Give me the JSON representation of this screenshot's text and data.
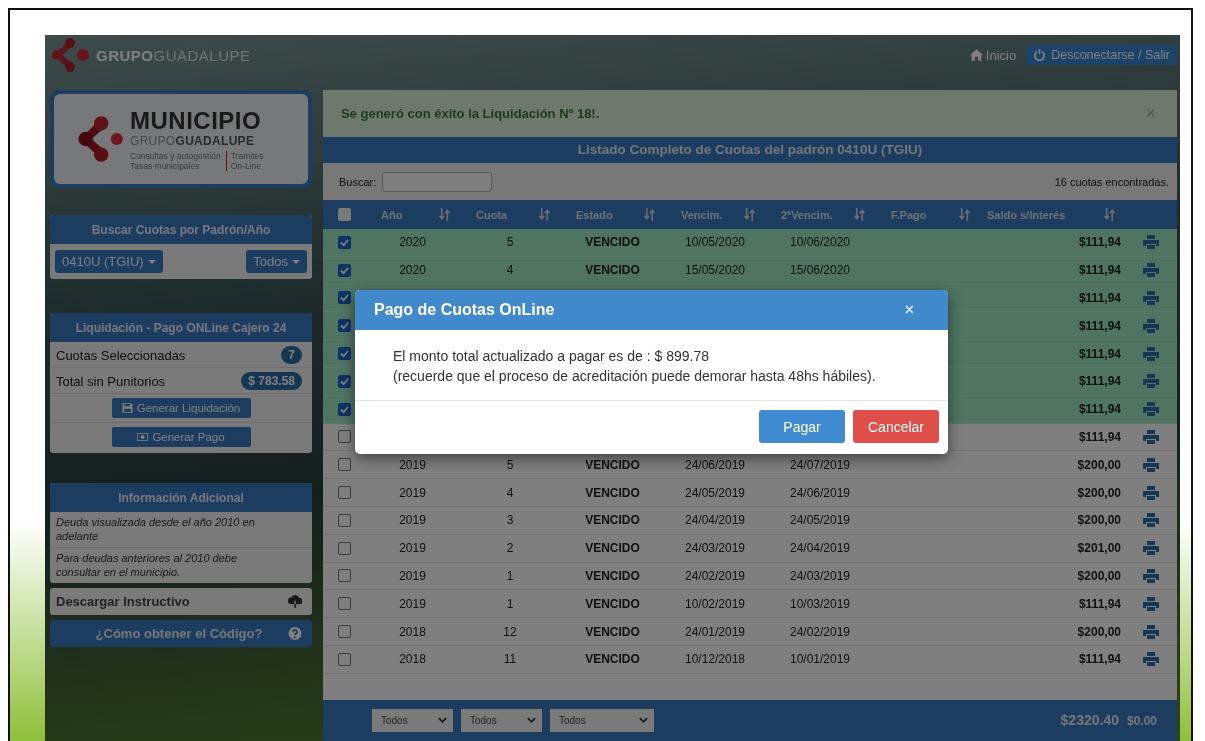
{
  "brand": {
    "logo_text": "**GRUPO**GUADALUPE"
  },
  "nav": {
    "home": "Inicio",
    "logout": "Desconectarse / Salir"
  },
  "municipio_card": {
    "title": "MUNICIPIO",
    "subtitle": "GRUPO**GUADALUPE**",
    "tagline": [
      "Consultas y autogestión",
      "Tasas municipales"
    ],
    "tramites": [
      "Tramites",
      "On-Line"
    ]
  },
  "search_panel": {
    "title": "Buscar Cuotas por Padrón/Año",
    "padron": "0410U (TGIU)",
    "year": "Todos"
  },
  "liquidacion_panel": {
    "title": "Liquidación - Pago ONLine Cajero 24",
    "items": [
      {
        "label": "Cuotas Seleccionadas",
        "badge": "7"
      },
      {
        "label": "Total sin Punitorios",
        "badge": "$ 783.58"
      }
    ],
    "buttons": [
      {
        "kind": "save",
        "label": "Generar Liquidación"
      },
      {
        "kind": "money",
        "label": "Generar Pago"
      }
    ]
  },
  "info_panel": {
    "title": "Información Adicional",
    "notes": [
      "Deuda visualizada desde el año 2010 en adelante",
      "Para deudas anteriores al 2010 debe consultar en el municipio."
    ]
  },
  "links": [
    {
      "kind": "download",
      "label": "Descargar Instructivo"
    },
    {
      "kind": "help",
      "label": "¿Cómo obtener el Código?"
    }
  ],
  "alert": {
    "message": "Se generó con éxito la Liquidación Nº 18!.",
    "close": "×"
  },
  "table": {
    "title": "Listado Completo de Cuotas del padrón 0410U (TGIU)",
    "search_label": "Buscar:",
    "count": "16 cuotas encontradas.",
    "all_checked": false,
    "columns": [
      "Año",
      "Cuota",
      "Estado",
      "Vencim.",
      "2ºVencim.",
      "F.Pago",
      "Saldo s/Interés"
    ],
    "rows": [
      {
        "checked": true,
        "year": "2020",
        "cuota": "5",
        "estado": "VENCIDO",
        "vencim": "10/05/2020",
        "vencim2": "10/06/2020",
        "saldo": "$111,94"
      },
      {
        "checked": true,
        "year": "2020",
        "cuota": "4",
        "estado": "VENCIDO",
        "vencim": "15/05/2020",
        "vencim2": "15/06/2020",
        "saldo": "$111,94"
      },
      {
        "checked": true,
        "saldo": "$111,94"
      },
      {
        "checked": true,
        "saldo": "$111,94"
      },
      {
        "checked": true,
        "saldo": "$111,94"
      },
      {
        "checked": true,
        "saldo": "$111,94"
      },
      {
        "checked": true,
        "saldo": "$111,94"
      },
      {
        "checked": false,
        "saldo": "$111,94"
      },
      {
        "checked": false,
        "year": "2019",
        "cuota": "5",
        "estado": "VENCIDO",
        "vencim": "24/06/2019",
        "vencim2": "24/07/2019",
        "saldo": "$200,00"
      },
      {
        "checked": false,
        "year": "2019",
        "cuota": "4",
        "estado": "VENCIDO",
        "vencim": "24/05/2019",
        "vencim2": "24/06/2019",
        "saldo": "$200,00"
      },
      {
        "checked": false,
        "year": "2019",
        "cuota": "3",
        "estado": "VENCIDO",
        "vencim": "24/04/2019",
        "vencim2": "24/05/2019",
        "saldo": "$200,00"
      },
      {
        "checked": false,
        "year": "2019",
        "cuota": "2",
        "estado": "VENCIDO",
        "vencim": "24/03/2019",
        "vencim2": "24/04/2019",
        "saldo": "$201,00"
      },
      {
        "checked": false,
        "year": "2019",
        "cuota": "1",
        "estado": "VENCIDO",
        "vencim": "24/02/2019",
        "vencim2": "24/03/2019",
        "saldo": "$200,00"
      },
      {
        "checked": false,
        "year": "2019",
        "cuota": "1",
        "estado": "VENCIDO",
        "vencim": "10/02/2019",
        "vencim2": "10/03/2019",
        "saldo": "$111,94"
      },
      {
        "checked": false,
        "year": "2018",
        "cuota": "12",
        "estado": "VENCIDO",
        "vencim": "24/01/2019",
        "vencim2": "24/02/2019",
        "saldo": "$200,00"
      },
      {
        "checked": false,
        "year": "2018",
        "cuota": "11",
        "estado": "VENCIDO",
        "vencim": "10/12/2018",
        "vencim2": "10/01/2019",
        "saldo": "$111,94"
      }
    ],
    "footer": {
      "filters": [
        "Todos",
        "Todos",
        "Todos"
      ],
      "total": "$2320.40",
      "interest": "$0.00"
    }
  },
  "modal": {
    "title": "Pago de Cuotas OnLine",
    "close": "×",
    "lines": [
      "El monto total actualizado a pagar es de : $ 899.78",
      "(recuerde que el proceso de acreditación puede demorar hasta 48hs hábiles)."
    ],
    "buttons": [
      {
        "kind": "primary",
        "label": "Pagar"
      },
      {
        "kind": "danger",
        "label": "Cancelar"
      }
    ]
  }
}
